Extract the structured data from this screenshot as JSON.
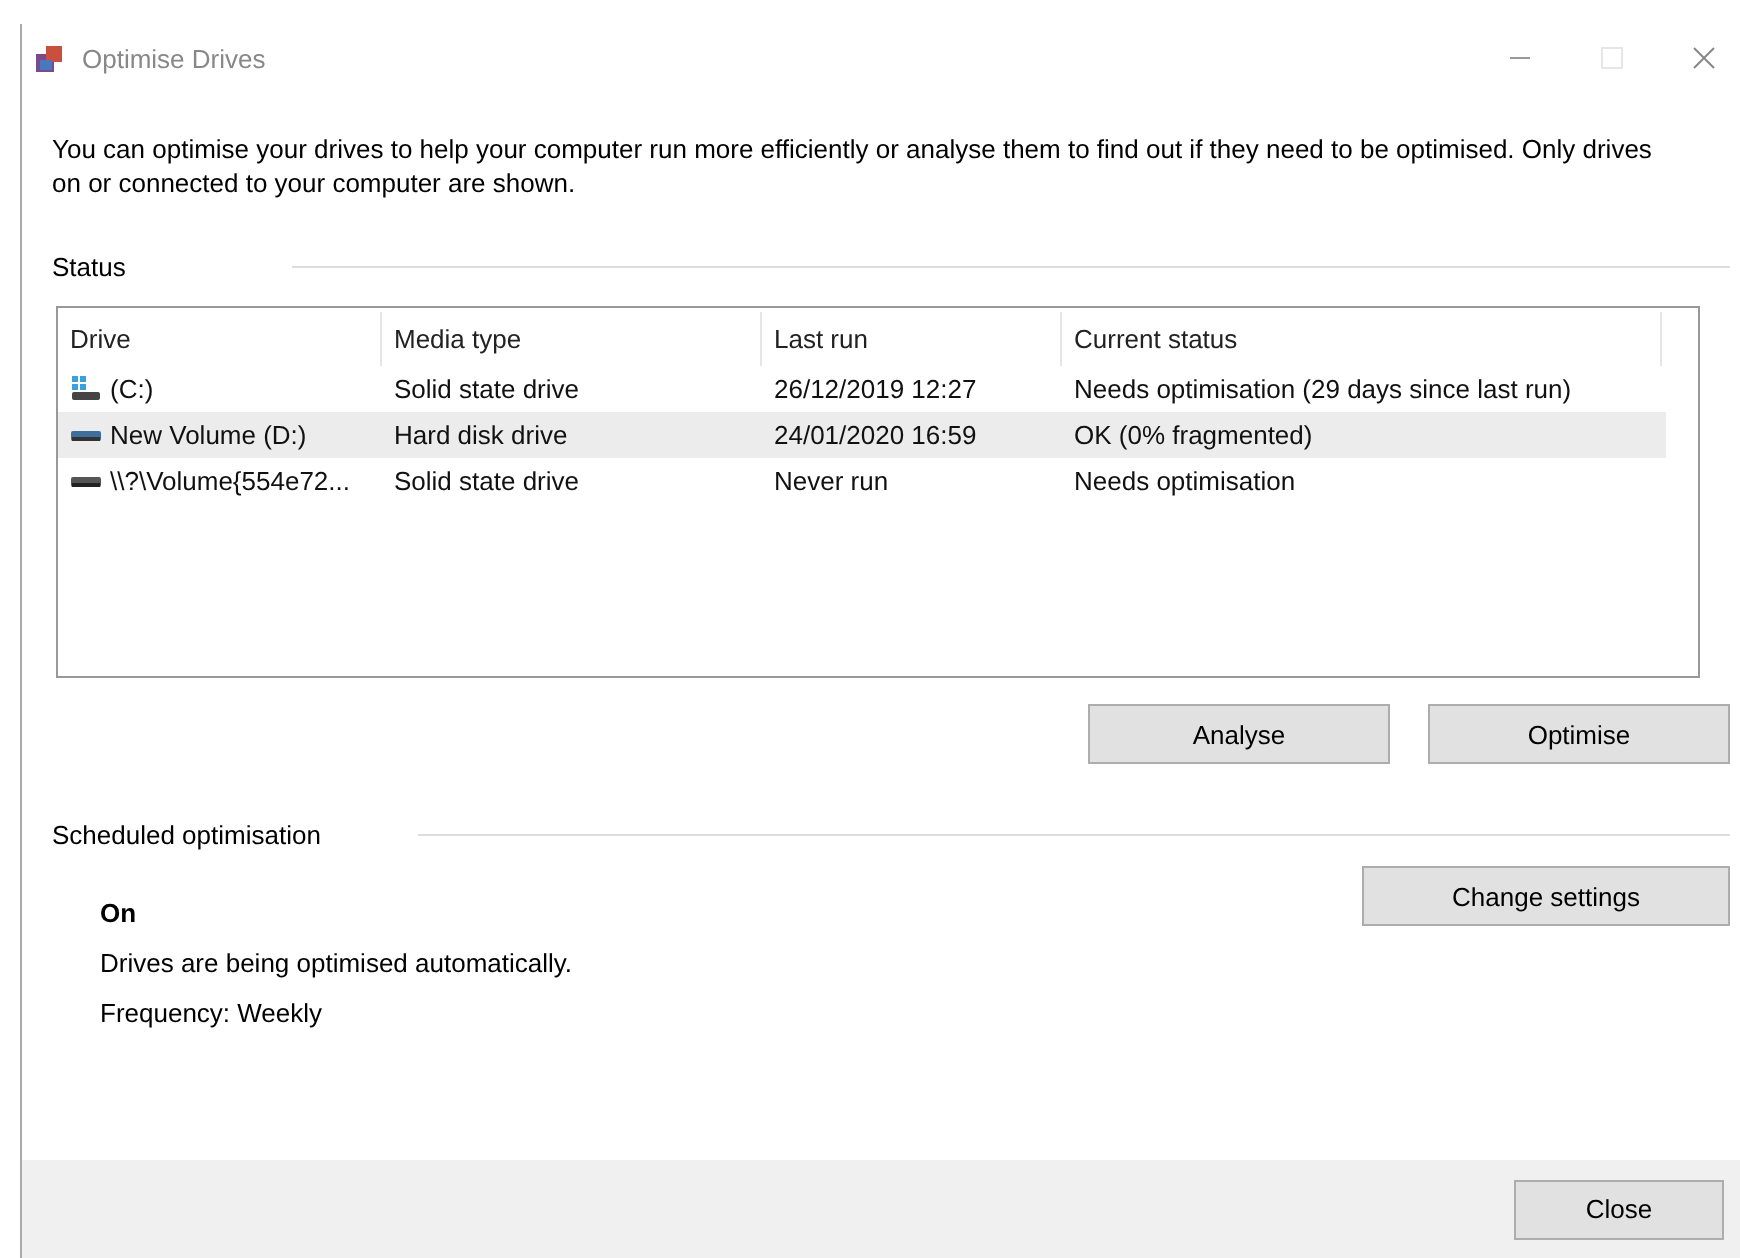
{
  "window": {
    "title": "Optimise Drives"
  },
  "description": "You can optimise your drives to help your computer run more efficiently or analyse them to find out if they need to be optimised. Only drives on or connected to your computer are shown.",
  "status": {
    "heading": "Status",
    "table": {
      "columns": [
        "Drive",
        "Media type",
        "Last run",
        "Current status"
      ],
      "rows": [
        {
          "kind": "system",
          "drive": "(C:)",
          "media_type": "Solid state drive",
          "last_run": "26/12/2019 12:27",
          "current_status": "Needs optimisation (29 days since last run)",
          "selected": false
        },
        {
          "kind": "volume",
          "drive": "New Volume (D:)",
          "media_type": "Hard disk drive",
          "last_run": "24/01/2020 16:59",
          "current_status": "OK (0% fragmented)",
          "selected": true
        },
        {
          "kind": "drive",
          "drive": "\\\\?\\Volume{554e72...",
          "media_type": "Solid state drive",
          "last_run": "Never run",
          "current_status": "Needs optimisation",
          "selected": false
        }
      ]
    },
    "buttons": [
      "Analyse",
      "Optimise"
    ]
  },
  "scheduled": {
    "heading": "Scheduled optimisation",
    "state": "On",
    "description": "Drives are being optimised automatically.",
    "frequency": "Frequency: Weekly",
    "button": "Change settings"
  },
  "footer": {
    "button": "Close"
  }
}
